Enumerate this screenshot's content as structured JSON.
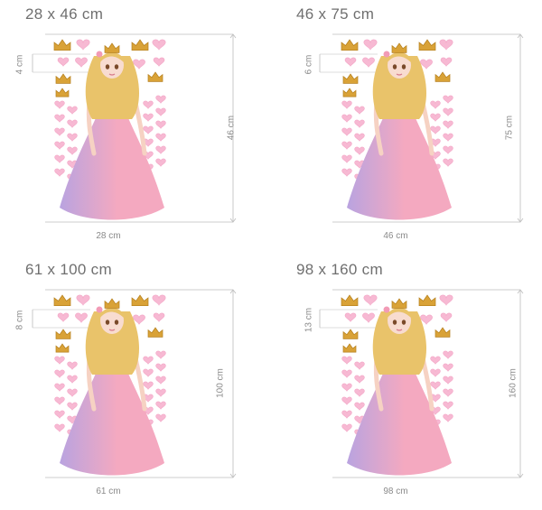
{
  "panels": [
    {
      "title": "28 x 46 cm",
      "width_label": "28 cm",
      "height_label": "46 cm",
      "sticker_label": "4 cm"
    },
    {
      "title": "46 x 75 cm",
      "width_label": "46 cm",
      "height_label": "75 cm",
      "sticker_label": "6 cm"
    },
    {
      "title": "61 x 100 cm",
      "width_label": "61 cm",
      "height_label": "100 cm",
      "sticker_label": "8 cm"
    },
    {
      "title": "98 x 160 cm",
      "width_label": "98 cm",
      "height_label": "160 cm",
      "sticker_label": "13 cm"
    }
  ],
  "colors": {
    "dress_pink": "#f4a9c0",
    "dress_lilac": "#b9a3e0",
    "hair": "#e9c36a",
    "crown_gold": "#d9a237",
    "heart_pink": "#f7b9d3",
    "guide_gray": "#bdbdbd"
  }
}
